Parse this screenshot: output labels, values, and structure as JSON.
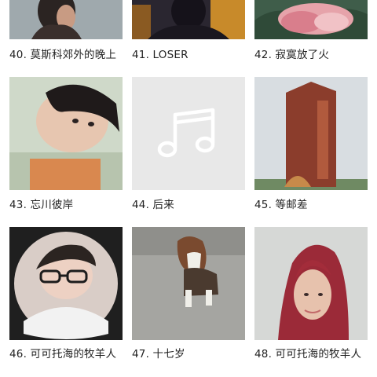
{
  "playlists": [
    {
      "title": "40. 莫斯科郊外的晚上",
      "image": "person-photo"
    },
    {
      "title": "41. LOSER",
      "image": "person-back-photo"
    },
    {
      "title": "42. 寂寞放了火",
      "image": "lotus-flower-photo"
    },
    {
      "title": "43. 忘川彼岸",
      "image": "selfie-photo"
    },
    {
      "title": "44. 后来",
      "image": "music-note-placeholder"
    },
    {
      "title": "45. 等邮差",
      "image": "tower-photo"
    },
    {
      "title": "46. 可可托海的牧羊人",
      "image": "selfie-glasses-photo"
    },
    {
      "title": "47. 十七岁",
      "image": "dog-photo"
    },
    {
      "title": "48. 可可托海的牧羊人",
      "image": "portrait-photo"
    }
  ],
  "colors": {
    "placeholder_bg": "#e8e8e8",
    "placeholder_icon": "#ffffff",
    "title_text": "#222222"
  }
}
